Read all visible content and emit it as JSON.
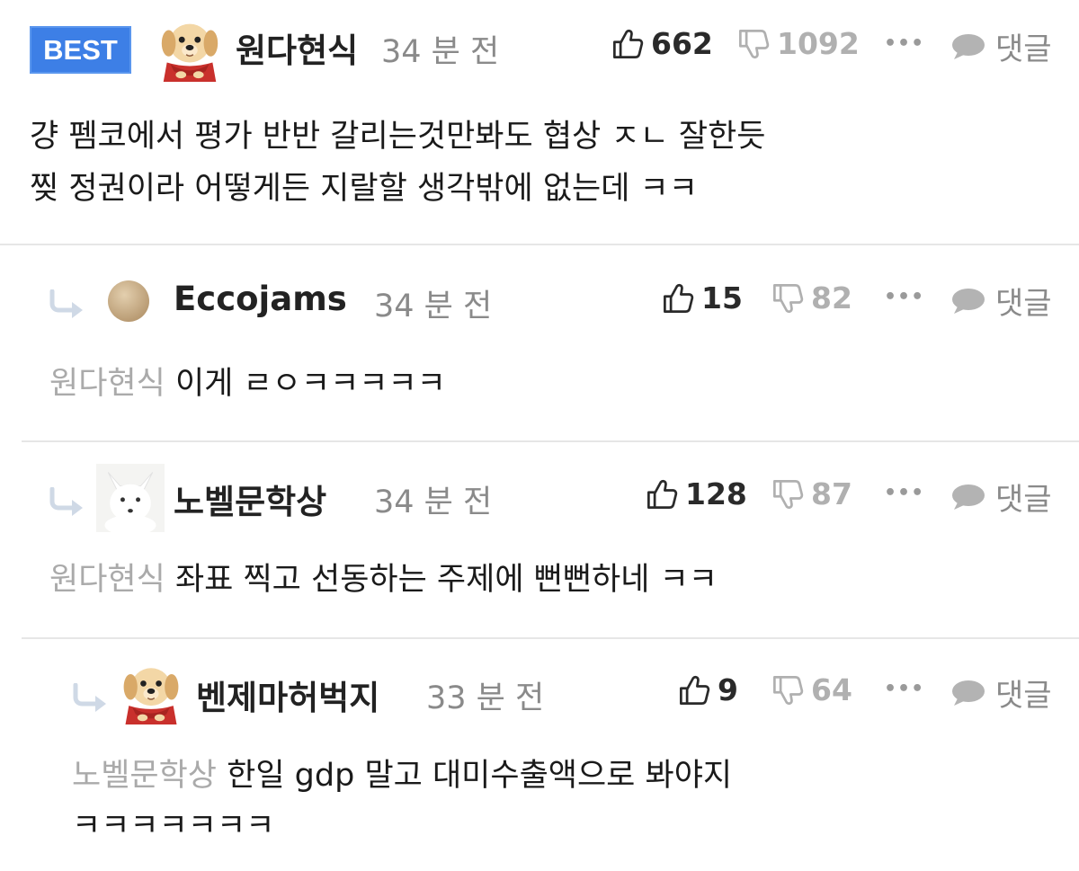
{
  "comments": [
    {
      "badge": "BEST",
      "avatar": "puppy-avatar",
      "author": "원다현식",
      "time": "34 분 전",
      "likes": "662",
      "dislikes": "1092",
      "more": "•••",
      "reply_label": "댓글",
      "lines": [
        "걍 펨코에서 평가 반반 갈리는것만봐도 협상 ㅈㄴ 잘한듯",
        "찢 정권이라 어떻게든 지랄할 생각밖에 없는데 ㅋㅋ"
      ]
    },
    {
      "avatar": "beige-circle-avatar",
      "author": "Eccojams",
      "time": "34 분 전",
      "likes": "15",
      "dislikes": "82",
      "more": "•••",
      "reply_label": "댓글",
      "mention": "원다현식",
      "text": "이게 ㄹㅇㅋㅋㅋㅋㅋ"
    },
    {
      "avatar": "white-fox-avatar",
      "author": "노벨문학상",
      "time": "34 분 전",
      "likes": "128",
      "dislikes": "87",
      "more": "•••",
      "reply_label": "댓글",
      "mention": "원다현식",
      "text": "좌표 찍고 선동하는 주제에 뻔뻔하네 ㅋㅋ"
    },
    {
      "avatar": "puppy-avatar",
      "author": "벤제마허벅지",
      "time": "33 분 전",
      "likes": "9",
      "dislikes": "64",
      "more": "•••",
      "reply_label": "댓글",
      "mention": "노벨문학상",
      "text": "한일 gdp 말고 대미수출액으로 봐야지",
      "text2": "ㅋㅋㅋㅋㅋㅋㅋ"
    }
  ],
  "colors": {
    "badge": "#3d7fe6",
    "muted": "#8a8a8a",
    "mention": "#aaaaaa",
    "divider": "#e6e6e6"
  }
}
